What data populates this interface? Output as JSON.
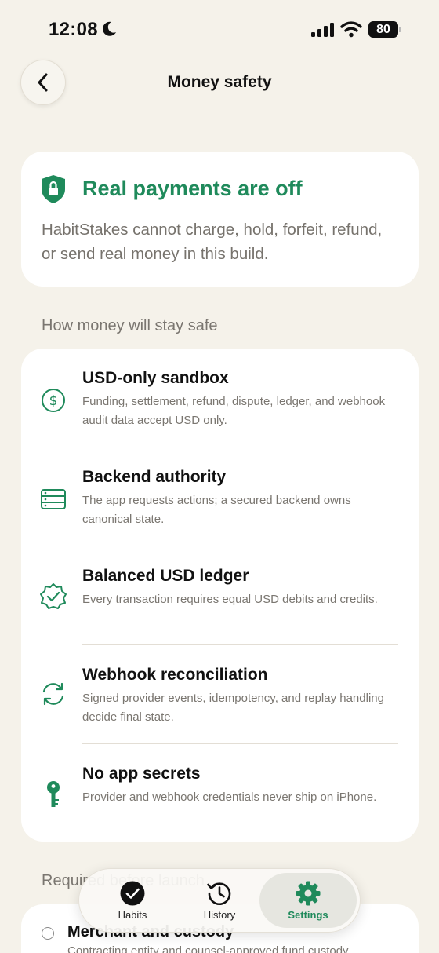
{
  "status": {
    "time": "12:08",
    "battery": "80"
  },
  "header": {
    "title": "Money safety"
  },
  "hero": {
    "title": "Real payments are off",
    "description": "HabitStakes cannot charge, hold, forfeit, refund, or send real money in this build."
  },
  "section_safety": "How money will stay safe",
  "items": [
    {
      "icon": "dollar-circle-icon",
      "title": "USD-only sandbox",
      "description": "Funding, settlement, refund, dispute, ledger, and webhook audit data accept USD only."
    },
    {
      "icon": "server-icon",
      "title": "Backend authority",
      "description": "The app requests actions; a secured backend owns canonical state."
    },
    {
      "icon": "checkmark-seal-icon",
      "title": "Balanced USD ledger",
      "description": "Every transaction requires equal USD debits and credits."
    },
    {
      "icon": "sync-arrows-icon",
      "title": "Webhook reconciliation",
      "description": "Signed provider events, idempotency, and replay handling decide final state."
    },
    {
      "icon": "key-icon",
      "title": "No app secrets",
      "description": "Provider and webhook credentials never ship on iPhone."
    }
  ],
  "section_required": "Required before launch",
  "requirement": {
    "title": "Merchant and custody",
    "description": "Contracting entity and counsel-approved fund custody."
  },
  "tabs": [
    {
      "label": "Habits",
      "icon": "checkmark-circle-icon",
      "selected": false
    },
    {
      "label": "History",
      "icon": "history-clock-icon",
      "selected": false
    },
    {
      "label": "Settings",
      "icon": "gear-icon",
      "selected": true
    }
  ],
  "colors": {
    "accent": "#1f8a5b",
    "background": "#f5f2ea",
    "card": "#ffffff",
    "secondary_text": "#7a7670"
  }
}
